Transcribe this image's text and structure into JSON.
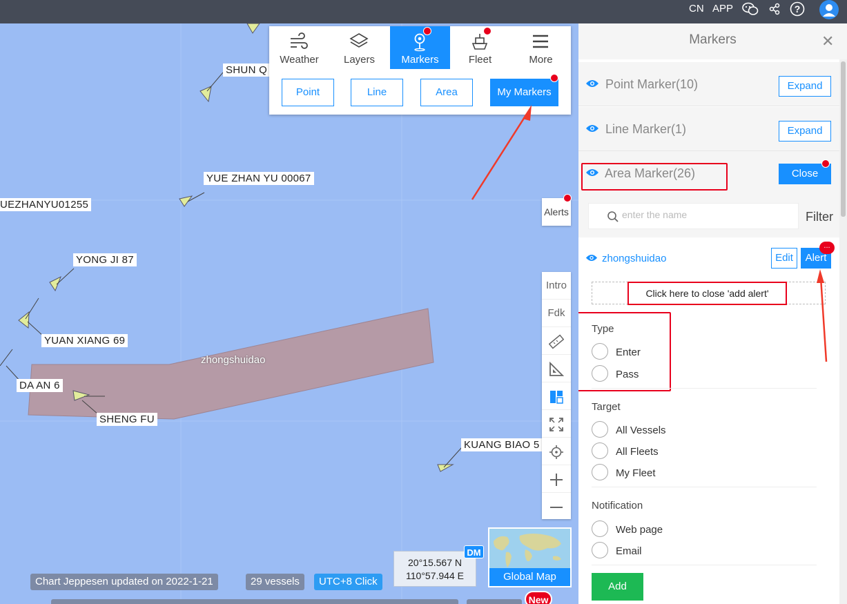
{
  "topbar": {
    "lang": "CN",
    "app": "APP"
  },
  "map": {
    "vessels": [
      "SHUN Q",
      "YUE ZHAN YU 00067",
      "UEZHANYU01255",
      "YONG JI 87",
      "YUAN XIANG 69",
      "DA AN 6",
      "SHENG FU",
      "KUANG BIAO 5"
    ],
    "area_label": "zhongshuidao",
    "status": {
      "chart": "Chart Jeppesen updated on 2022-1-21",
      "vessels": "29 vessels",
      "utc": "UTC+8 Click"
    },
    "coords": {
      "lat": "20°15.567 N",
      "lon": "110°57.944 E",
      "format": "DM"
    },
    "global_map": "Global Map",
    "new_badge": "New",
    "alerts": "Alerts",
    "tools": {
      "intro": "Intro",
      "fdk": "Fdk"
    }
  },
  "toolpanel": {
    "tabs": [
      {
        "label": "Weather",
        "icon": "wind-icon"
      },
      {
        "label": "Layers",
        "icon": "layers-icon"
      },
      {
        "label": "Markers",
        "icon": "marker-pin-icon",
        "active": true
      },
      {
        "label": "Fleet",
        "icon": "ship-icon"
      },
      {
        "label": "More",
        "icon": "menu-icon"
      }
    ],
    "sub": [
      "Point",
      "Line",
      "Area",
      "My Markers"
    ]
  },
  "sidebar": {
    "title": "Markers",
    "categories": [
      {
        "label": "Point Marker(10)",
        "button": "Expand"
      },
      {
        "label": "Line Marker(1)",
        "button": "Expand"
      },
      {
        "label": "Area Marker(26)",
        "button": "Close"
      }
    ],
    "search_placeholder": "enter the name",
    "filter": "Filter",
    "item": {
      "name": "zhongshuidao",
      "edit": "Edit",
      "alert": "Alert",
      "badge": "..."
    },
    "close_hint": "Click here to close 'add alert'",
    "type": {
      "title": "Type",
      "options": [
        "Enter",
        "Pass"
      ]
    },
    "target": {
      "title": "Target",
      "options": [
        "All Vessels",
        "All Fleets",
        "My Fleet"
      ]
    },
    "notification": {
      "title": "Notification",
      "options": [
        "Web page",
        "Email"
      ]
    },
    "add": "Add"
  },
  "colors": {
    "accent": "#1890ff",
    "highlight": "#e8001c",
    "add": "#1db954",
    "map_water": "#9bbcf4",
    "area_fill": "#b59aa6"
  }
}
